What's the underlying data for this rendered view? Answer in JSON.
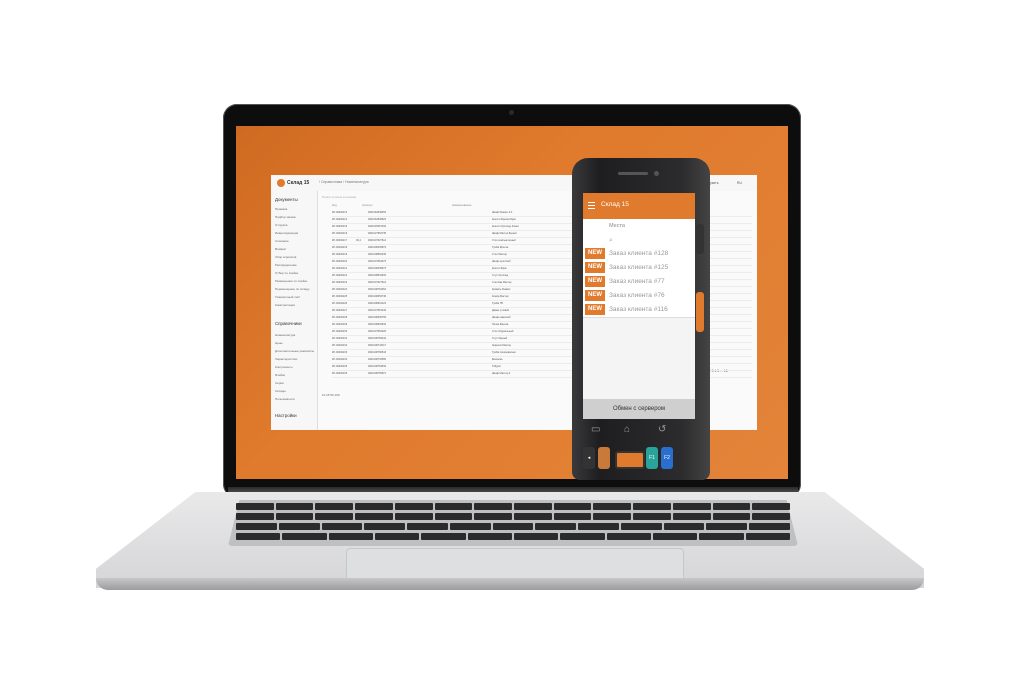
{
  "app": {
    "logo_text": "Склад 15",
    "breadcrumb": "/ Справочники / Номенклатура",
    "search_placeholder": "Поиск по всем колонкам",
    "columns": [
      "Код",
      "Артикул",
      "Наименование"
    ],
    "sidebar": {
      "section_documents": "Документы",
      "documents_items": [
        "Приемка",
        "Подбор заказа",
        "Отгрузка",
        "Инвентаризация",
        "Списание",
        "Возврат",
        "Сбор агрегатов",
        "Распределение",
        "Отбор по ячейке",
        "Размещение по ячейке",
        "Перемещение по складу",
        "Упаковочный лист",
        "Комплектация"
      ],
      "section_references": "Справочники",
      "references_items": [
        "Номенклатура",
        "Цены",
        "Дополнительные реквизиты",
        "Характеристики",
        "Контрагенты",
        "Ячейки",
        "Серии",
        "Склады",
        "Пользователи"
      ],
      "section_settings": "Настройки"
    },
    "rows": [
      {
        "code": "КР-00000213",
        "sku": "",
        "barcode": "4600164546453",
        "name": "Шкаф Ремикс 4-3"
      },
      {
        "code": "КР-00000214",
        "sku": "",
        "barcode": "4600164536523",
        "name": "Кресло Фреска Брик"
      },
      {
        "code": "КР-00000215",
        "sku": "",
        "barcode": "4600145367634",
        "name": "Кресло Ортопед Клюкс"
      },
      {
        "code": "КР-00000216",
        "sku": "",
        "barcode": "4600127654735",
        "name": "Шкаф Мастер Белый"
      },
      {
        "code": "КР-00000217",
        "sku": "36,4",
        "barcode": "4600107627612",
        "name": "Стол компьютерный"
      },
      {
        "code": "КР-00000218",
        "sku": "",
        "barcode": "4600108435874",
        "name": "Тумба Фреска"
      },
      {
        "code": "КР-00000219",
        "sku": "",
        "barcode": "4600108562435",
        "name": "Стол Мастер"
      },
      {
        "code": "КР-00000220",
        "sku": "",
        "barcode": "4600137564373",
        "name": "Шкаф-купе Кейт"
      },
      {
        "code": "КР-00000221",
        "sku": "",
        "barcode": "4600108435673",
        "name": "Кресло Брик"
      },
      {
        "code": "КР-00000222",
        "sku": "",
        "barcode": "4600108534634",
        "name": "Стул Ортопед"
      },
      {
        "code": "КР-00000223",
        "sku": "",
        "barcode": "4600107627612",
        "name": "Стеллаж Мастер"
      },
      {
        "code": "КР-00000224",
        "sku": "",
        "barcode": "4600108764364",
        "name": "Кровать Ремикс"
      },
      {
        "code": "КР-00000225",
        "sku": "",
        "barcode": "4600108453746",
        "name": "Комод Мастер"
      },
      {
        "code": "КР-00000226",
        "sku": "",
        "barcode": "4600108524123",
        "name": "Тумба ТВ"
      },
      {
        "code": "КР-00000227",
        "sku": "",
        "barcode": "4600107615243",
        "name": "Диван угловой"
      },
      {
        "code": "КР-00000228",
        "sku": "",
        "barcode": "4600108645765",
        "name": "Шкаф навесной"
      },
      {
        "code": "КР-00000229",
        "sku": "",
        "barcode": "4600108634532",
        "name": "Полка Фреска"
      },
      {
        "code": "КР-00000230",
        "sku": "",
        "barcode": "4600107654326",
        "name": "Стол Журнальный"
      },
      {
        "code": "КР-00000231",
        "sku": "",
        "barcode": "4600108765432",
        "name": "Стул барный"
      },
      {
        "code": "КР-00000232",
        "sku": "",
        "barcode": "4600108743217",
        "name": "Зеркало Мастер"
      },
      {
        "code": "КР-00000233",
        "sku": "",
        "barcode": "4600108766543",
        "name": "Тумба прикроватная"
      },
      {
        "code": "КР-00000234",
        "sku": "",
        "barcode": "4600108734565",
        "name": "Вешалка"
      },
      {
        "code": "КР-00000235",
        "sku": "",
        "barcode": "4600108764532",
        "name": "Табурет"
      },
      {
        "code": "КР-00000236",
        "sku": "",
        "barcode": "4600108765871",
        "name": "Шкаф Мастер 2"
      }
    ],
    "pager": "10   25   50   100",
    "pagination": "1  2  3  4  5  ...  16",
    "right_controls": [
      "Загрузить",
      "RU"
    ]
  },
  "device": {
    "title": "Склад 15",
    "first_field": "Места",
    "orders": [
      {
        "badge": "NEW",
        "label": "Заказ клиента #128"
      },
      {
        "badge": "NEW",
        "label": "Заказ клиента #125"
      },
      {
        "badge": "NEW",
        "label": "Заказ клиента #77"
      },
      {
        "badge": "NEW",
        "label": "Заказ клиента #76"
      },
      {
        "badge": "NEW",
        "label": "Заказ клиента #116"
      }
    ],
    "exchange_button": "Обмен с сервером",
    "keys": [
      "F1",
      "F2"
    ]
  },
  "colors": {
    "accent": "#e07a2c",
    "screen_bg": "#d9742b",
    "device_body": "#2a2a2c"
  },
  "icons": [
    "menu-icon",
    "search-icon",
    "back-nav-icon",
    "home-nav-icon",
    "return-nav-icon"
  ]
}
